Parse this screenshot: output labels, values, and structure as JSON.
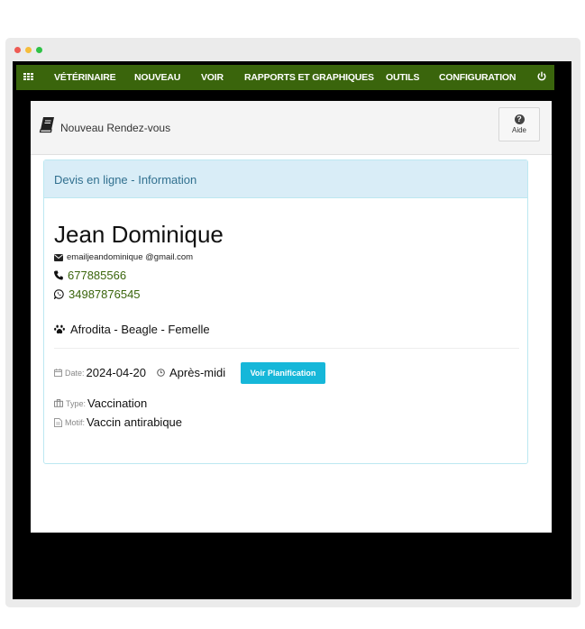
{
  "navbar": {
    "items": [
      {
        "label": "VÉTÉRINAIRE"
      },
      {
        "label": "NOUVEAU"
      },
      {
        "label": "VOIR"
      },
      {
        "label": "RAPPORTS ET GRAPHIQUES"
      },
      {
        "label": "OUTILS"
      },
      {
        "label": "CONFIGURATION"
      }
    ],
    "grid_icon": "grid-icon",
    "power_icon": "power-icon"
  },
  "page": {
    "title": "Nouveau Rendez-vous",
    "help_label": "Aide"
  },
  "panel": {
    "heading": "Devis en ligne - Information",
    "client": {
      "name": "Jean Dominique",
      "email": "emailjeandominique @gmail.com",
      "phone": "677885566",
      "whatsapp": "34987876545"
    },
    "pet": "Afrodita - Beagle - Femelle",
    "appointment": {
      "date_label": "Date:",
      "date": "2024-04-20",
      "time": "Après-midi",
      "plan_button": "Voir Planification",
      "type_label": "Type:",
      "type": "Vaccination",
      "motif_label": "Motif:",
      "motif": "Vaccin antirabique"
    }
  },
  "colors": {
    "navbar": "#3a650c",
    "accent_green": "#3a650c",
    "info_heading_bg": "#d9edf7",
    "info_heading_text": "#31708f",
    "button": "#16b7d9"
  }
}
